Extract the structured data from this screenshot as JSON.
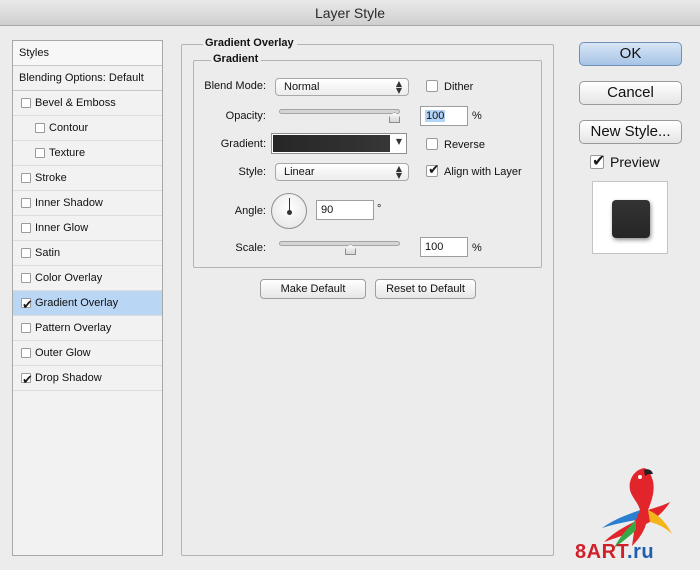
{
  "window": {
    "title": "Layer Style"
  },
  "styles_panel": {
    "header": "Styles",
    "blending_options": "Blending Options: Default",
    "items": [
      {
        "label": "Bevel & Emboss",
        "checked": false,
        "indent": false,
        "selected": false
      },
      {
        "label": "Contour",
        "checked": false,
        "indent": true,
        "selected": false
      },
      {
        "label": "Texture",
        "checked": false,
        "indent": true,
        "selected": false
      },
      {
        "label": "Stroke",
        "checked": false,
        "indent": false,
        "selected": false
      },
      {
        "label": "Inner Shadow",
        "checked": false,
        "indent": false,
        "selected": false
      },
      {
        "label": "Inner Glow",
        "checked": false,
        "indent": false,
        "selected": false
      },
      {
        "label": "Satin",
        "checked": false,
        "indent": false,
        "selected": false
      },
      {
        "label": "Color Overlay",
        "checked": false,
        "indent": false,
        "selected": false
      },
      {
        "label": "Gradient Overlay",
        "checked": true,
        "indent": false,
        "selected": true
      },
      {
        "label": "Pattern Overlay",
        "checked": false,
        "indent": false,
        "selected": false
      },
      {
        "label": "Outer Glow",
        "checked": false,
        "indent": false,
        "selected": false
      },
      {
        "label": "Drop Shadow",
        "checked": true,
        "indent": false,
        "selected": false
      }
    ]
  },
  "gradient_overlay": {
    "section_title": "Gradient Overlay",
    "group_title": "Gradient",
    "blend_mode_label": "Blend Mode:",
    "blend_mode_value": "Normal",
    "dither_label": "Dither",
    "dither_checked": false,
    "opacity_label": "Opacity:",
    "opacity_value": "100",
    "opacity_fraction": 1.0,
    "percent": "%",
    "gradient_label": "Gradient:",
    "gradient_colors": [
      "#262626",
      "#363636"
    ],
    "reverse_label": "Reverse",
    "reverse_checked": false,
    "style_label": "Style:",
    "style_value": "Linear",
    "align_label": "Align with Layer",
    "align_checked": true,
    "angle_label": "Angle:",
    "angle_value": "90",
    "degree": "°",
    "scale_label": "Scale:",
    "scale_value": "100",
    "scale_fraction": 0.6,
    "make_default": "Make Default",
    "reset_default": "Reset to Default"
  },
  "actions": {
    "ok": "OK",
    "cancel": "Cancel",
    "new_style": "New Style...",
    "preview_label": "Preview",
    "preview_checked": true
  },
  "watermark": {
    "brand": "8ART",
    "suffix": ".ru"
  },
  "icons": {
    "select_arrows": "updown-arrows-icon",
    "dropdown": "triangle-down-icon",
    "check": "checkmark-icon",
    "watermark_logo": "parrot-logo"
  }
}
